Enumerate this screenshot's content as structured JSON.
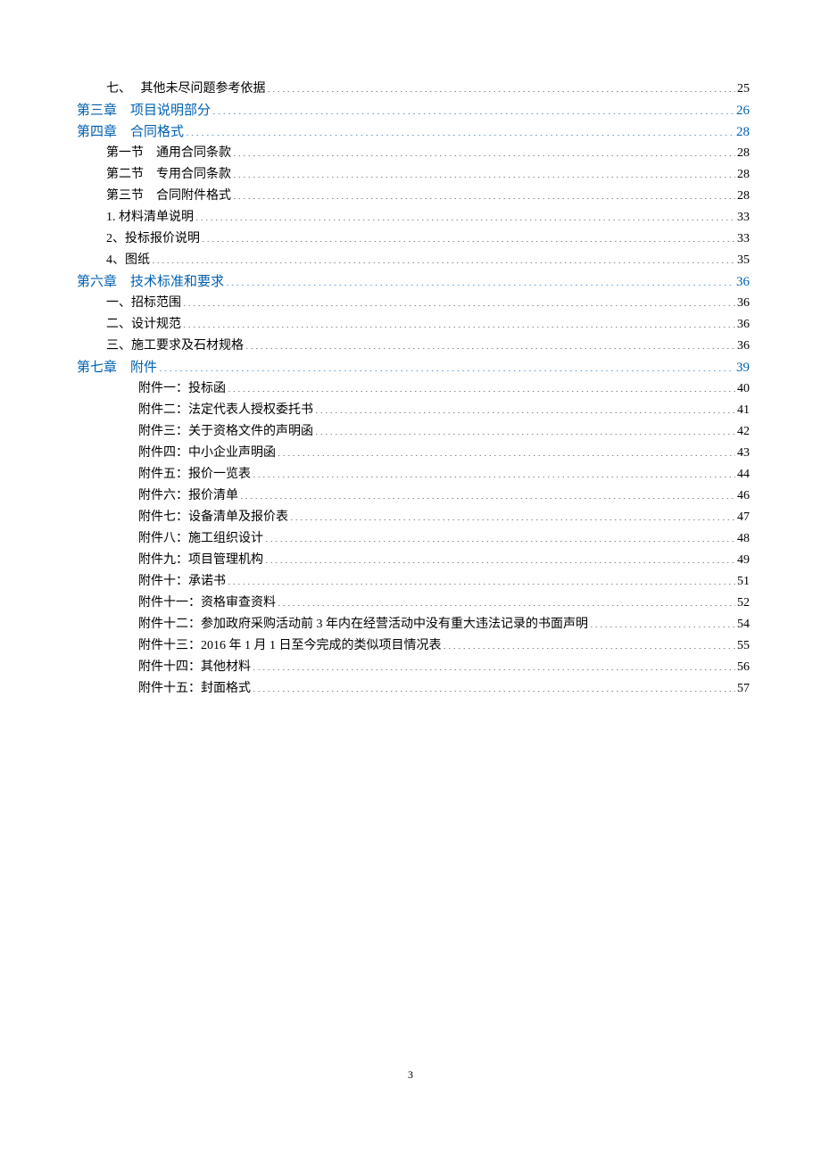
{
  "toc": [
    {
      "label": "七、　 其他未尽问题参考依据",
      "page": "25",
      "level": 1,
      "class": ""
    },
    {
      "label": "第三章　项目说明部分",
      "page": "26",
      "level": 0,
      "class": "chapter"
    },
    {
      "label": "第四章　合同格式",
      "page": "28",
      "level": 0,
      "class": "chapter"
    },
    {
      "label": "第一节　通用合同条款",
      "page": "28",
      "level": 1,
      "class": ""
    },
    {
      "label": "第二节　专用合同条款",
      "page": "28",
      "level": 1,
      "class": ""
    },
    {
      "label": "第三节　合同附件格式",
      "page": "28",
      "level": 1,
      "class": ""
    },
    {
      "label": "1. 材料清单说明",
      "page": "33",
      "level": 1,
      "class": ""
    },
    {
      "label": "2、投标报价说明",
      "page": "33",
      "level": 1,
      "class": ""
    },
    {
      "label": "4、图纸",
      "page": "35",
      "level": 1,
      "class": ""
    },
    {
      "label": "第六章　技术标准和要求",
      "page": "36",
      "level": 0,
      "class": "chapter"
    },
    {
      "label": "一、招标范围",
      "page": "36",
      "level": 1,
      "class": ""
    },
    {
      "label": "二、设计规范",
      "page": "36",
      "level": 1,
      "class": ""
    },
    {
      "label": "三、施工要求及石材规格",
      "page": "36",
      "level": 1,
      "class": ""
    },
    {
      "label": "第七章　附件",
      "page": "39",
      "level": 0,
      "class": "chapter"
    },
    {
      "label": "附件一：投标函",
      "page": " 40",
      "level": 2,
      "class": ""
    },
    {
      "label": "附件二：法定代表人授权委托书",
      "page": " 41",
      "level": 2,
      "class": ""
    },
    {
      "label": "附件三：关于资格文件的声明函",
      "page": " 42",
      "level": 2,
      "class": ""
    },
    {
      "label": "附件四：中小企业声明函",
      "page": " 43",
      "level": 2,
      "class": ""
    },
    {
      "label": "附件五：报价一览表",
      "page": " 44",
      "level": 2,
      "class": ""
    },
    {
      "label": "附件六：报价清单",
      "page": " 46",
      "level": 2,
      "class": ""
    },
    {
      "label": "附件七：设备清单及报价表",
      "page": " 47",
      "level": 2,
      "class": ""
    },
    {
      "label": "附件八：施工组织设计",
      "page": " 48",
      "level": 2,
      "class": ""
    },
    {
      "label": "附件九：项目管理机构",
      "page": " 49",
      "level": 2,
      "class": ""
    },
    {
      "label": "附件十：承诺书",
      "page": " 51",
      "level": 2,
      "class": ""
    },
    {
      "label": "附件十一：资格审查资料",
      "page": " 52",
      "level": 2,
      "class": ""
    },
    {
      "label": "附件十二：参加政府采购活动前 3 年内在经营活动中没有重大违法记录的书面声明",
      "page": " 54",
      "level": 2,
      "class": ""
    },
    {
      "label": "附件十三：2016 年 1 月 1 日至今完成的类似项目情况表",
      "page": " 55",
      "level": 2,
      "class": ""
    },
    {
      "label": "附件十四：其他材料",
      "page": " 56",
      "level": 2,
      "class": ""
    },
    {
      "label": "附件十五：封面格式",
      "page": " 57",
      "level": 2,
      "class": ""
    }
  ],
  "page_number": "3"
}
